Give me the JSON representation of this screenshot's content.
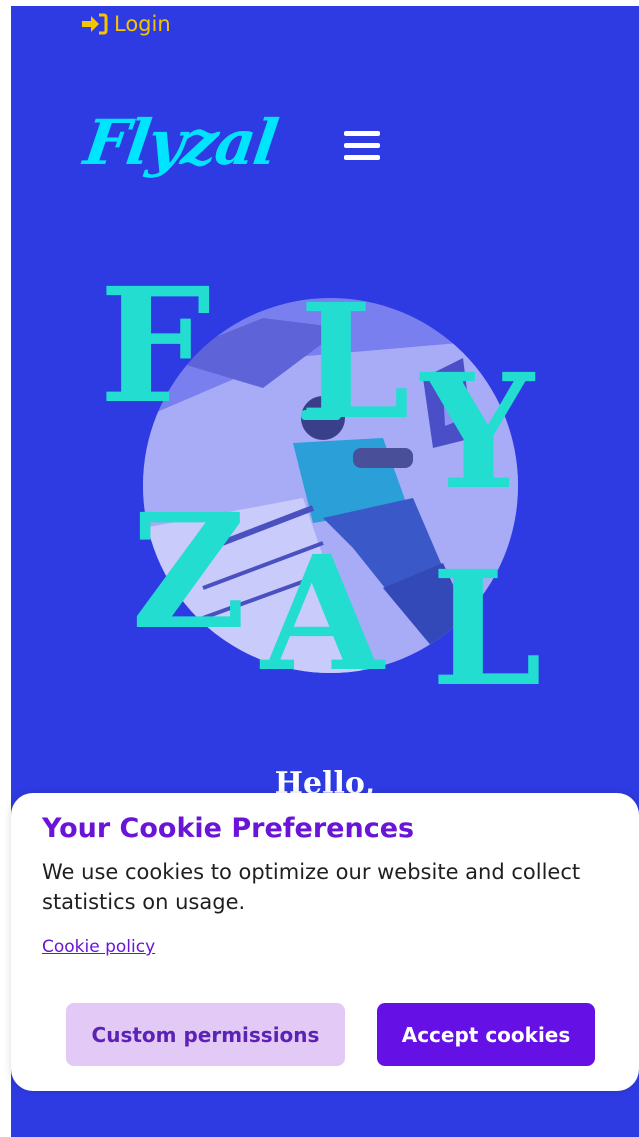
{
  "header": {
    "login_label": "Login",
    "login_icon": "sign-in-icon",
    "logo_text": "Flyzal",
    "menu_icon": "hamburger-menu-icon"
  },
  "hero": {
    "letters": [
      "F",
      "L",
      "Y",
      "Z",
      "A",
      "L"
    ],
    "greeting": "Hello,"
  },
  "cookie_banner": {
    "title": "Your Cookie Preferences",
    "message": "We use cookies to optimize our website and collect statistics on usage.",
    "policy_link": "Cookie policy",
    "custom_button": "Custom permissions",
    "accept_button": "Accept cookies"
  },
  "colors": {
    "background": "#2e3be3",
    "logo": "#00e5ff",
    "login": "#f5c400",
    "letters": "#22ddd0",
    "cookie_title": "#6a14d8",
    "accept_button": "#6511e6",
    "custom_button": "#e2c9f6"
  }
}
